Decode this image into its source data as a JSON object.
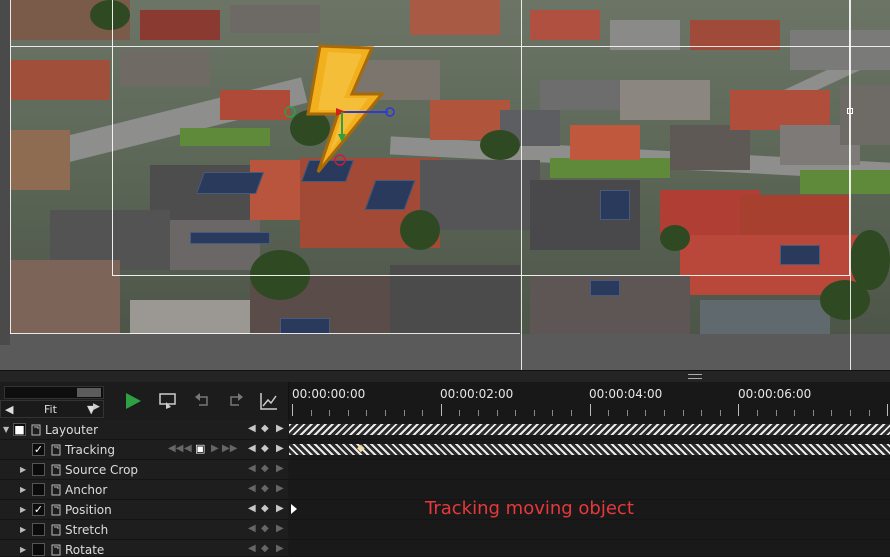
{
  "toolbar": {
    "fit_label": "Fit",
    "play_icon": "play-icon",
    "loop_icon": "loop-playback-icon",
    "undo_icon": "undo-icon",
    "redo_icon": "redo-icon",
    "graph_icon": "graph-editor-icon"
  },
  "ruler": {
    "ticks": [
      "00:00:00:00",
      "00:00:02:00",
      "00:00:04:00",
      "00:00:06:00"
    ]
  },
  "tracks": {
    "layouter": {
      "label": "Layouter",
      "checked": true
    },
    "tracking": {
      "label": "Tracking",
      "checked": true
    },
    "source_crop": {
      "label": "Source Crop",
      "checked": false
    },
    "anchor": {
      "label": "Anchor",
      "checked": false
    },
    "position": {
      "label": "Position",
      "checked": true
    },
    "stretch": {
      "label": "Stretch",
      "checked": false
    },
    "rotate": {
      "label": "Rotate",
      "checked": false
    }
  },
  "annotation": "Tracking moving object",
  "colors": {
    "accent_green": "#2ea043",
    "annotation_red": "#e8383c",
    "bolt_yellow": "#f2b01e"
  }
}
